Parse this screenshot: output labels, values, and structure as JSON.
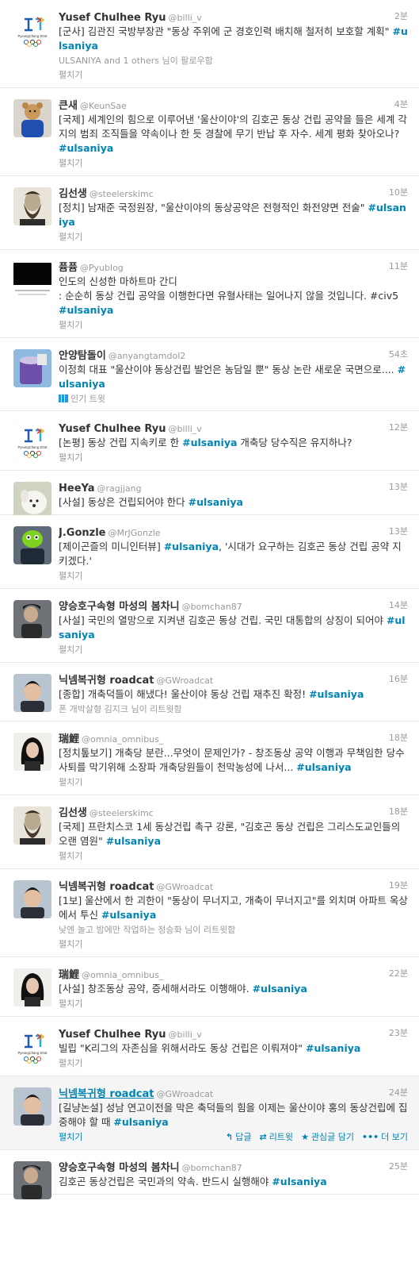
{
  "feed": {
    "tweets": [
      {
        "name": "Yusef Chulhee Ryu",
        "handle": "@billi_v",
        "time": "2분",
        "avatar": "pyeongchang-logo",
        "avatar_caption": "PyeongChang 2018",
        "text": "[군사] 김관진 국방부장관 \"동상 주위에 군 경호인력 배치해 철저히 보호할 계획\" ",
        "hashtag": "#ulsaniya",
        "context": "ULSANIYA and 1 others 님이 팔로우함",
        "expand": "펼치기"
      },
      {
        "name": "큰새",
        "handle": "@KeunSae",
        "time": "4분",
        "avatar": "blue-teddy-bear",
        "text": "[국제] 세계인의 힘으로 이루어낸 '울산이야'의 김호곤 동상 건립 공약을 들은 세계 각지의 범죄 조직들을 약속이나 한 듯 경찰에 무기 반납 후 자수. 세계 평화 찾아오나? ",
        "hashtag": "#ulsaniya",
        "expand": "펼치기"
      },
      {
        "name": "김선생",
        "handle": "@steelerskimc",
        "time": "10분",
        "avatar": "bearded-man-portrait",
        "text": "[정치] 남재준 국정원장, \"울산이야의 동상공약은 전형적인 화전양면 전술\" ",
        "hashtag": "#ulsaniya",
        "expand": "펼치기"
      },
      {
        "name": "퓸퓸",
        "handle": "@Pyublog",
        "time": "11분",
        "avatar": "black-banner",
        "text": "인도의 신성한 마하트마 간디\n: 순순히 동상 건립 공약을 이행한다면 유혈사태는 일어나지 않을 것입니다. #civ5 ",
        "hashtag": "#ulsaniya",
        "expand": "펼치기"
      },
      {
        "name": "안양탐돌이",
        "handle": "@anyangtamdol2",
        "time": "54초",
        "avatar": "purple-cup",
        "text": "이정희 대표 \"울산이야 동상건립 발언은 농담일 뿐\" 동상 논란 새로운 국면으로.... ",
        "hashtag": "#ulsaniya",
        "popular": "인기 트윗",
        "expand": ""
      },
      {
        "name": "Yusef Chulhee Ryu",
        "handle": "@billi_v",
        "time": "12분",
        "avatar": "pyeongchang-logo",
        "avatar_caption": "PyeongChang 2018",
        "text": "[논평] 동상 건립 지속키로 한 ",
        "hashtag": "#ulsaniya",
        "text_after": " 개축당 당수직은 유지하나?",
        "expand": "펼치기"
      },
      {
        "name": "HeeYa",
        "handle": "@ragjjang",
        "time": "13분",
        "avatar": "white-puppy",
        "text": "[사설] 동상은 건립되어야 한다 ",
        "hashtag": "#ulsaniya",
        "expand": ""
      },
      {
        "name": "J.Gonzle",
        "handle": "@MrJGonzle",
        "time": "13분",
        "avatar": "green-creature",
        "text": "[제이곤즐의 미니인터뷰] ",
        "hashtag": "#ulsaniya",
        "text_after": ", '시대가 요구하는 김호곤 동상 건립 공약 지키겠다.'",
        "expand": "펼치기"
      },
      {
        "name": "양승호구속형 마성의 봄차니",
        "handle": "@bomchan87",
        "time": "14분",
        "avatar": "dark-portrait",
        "text": "[사설] 국민의 열망으로 지켜낸 김호곤 동상 건립. 국민 대통합의 상징이 되어야 ",
        "hashtag": "#ulsaniya",
        "expand": "펼치기"
      },
      {
        "name": "닉넴복귀형 roadcat",
        "handle": "@GWroadcat",
        "time": "16분",
        "avatar": "boy-photo",
        "text": "[종합] 개축덕들이 해냈다! 울산이야 동상 건립 재추진 확정! ",
        "hashtag": "#ulsaniya",
        "context": "폰 개박살형 김지크 님이 리트윗함",
        "expand": ""
      },
      {
        "name": "瑞鯉",
        "handle": "@omnia_omnibus_",
        "time": "18분",
        "avatar": "girl-portrait",
        "text": "[정치톺보기] 개축당 분란...무엇이 문제인가? - 창조동상 공약 이행과 무책임한 당수 사퇴를 막기위해 소장파 개축당원들이 천막농성에 나서... ",
        "hashtag": "#ulsaniya",
        "expand": "펼치기"
      },
      {
        "name": "김선생",
        "handle": "@steelerskimc",
        "time": "18분",
        "avatar": "bearded-man-portrait",
        "text": "[국제] 프란치스코 1세 동상건립 촉구 강론, \"김호곤 동상 건립은 그리스도교인들의 오랜 염원\" ",
        "hashtag": "#ulsaniya",
        "expand": "펼치기"
      },
      {
        "name": "닉넴복귀형 roadcat",
        "handle": "@GWroadcat",
        "time": "19분",
        "avatar": "boy-photo",
        "text": "[1보] 울산에서 한 괴한이 \"동상이 무너지고, 개축이 무너지고\"를 외치며 아파트 옥상에서 투신 ",
        "hashtag": "#ulsaniya",
        "context": "낮엔 놀고 밤에만 작업하는 정승화 님이 리트윗함",
        "expand": "펼치기"
      },
      {
        "name": "瑞鯉",
        "handle": "@omnia_omnibus_",
        "time": "22분",
        "avatar": "girl-portrait",
        "text": "[사설] 창조동상 공약, 증세해서라도 이행해야. ",
        "hashtag": "#ulsaniya",
        "expand": "펼치기"
      },
      {
        "name": "Yusef Chulhee Ryu",
        "handle": "@billi_v",
        "time": "23분",
        "avatar": "pyeongchang-logo",
        "avatar_caption": "PyeongChang 2018",
        "text": "빌립 \"K리그의 자존심을 위해서라도 동상 건립은 이뤄져야\" ",
        "hashtag": "#ulsaniya",
        "expand": "펼치기"
      },
      {
        "name": "닉넴복귀형 roadcat",
        "handle": "@GWroadcat",
        "time": "24분",
        "avatar": "boy-photo",
        "text": "[길냥논설] 성남 연고이전을 막은 축덕들의 힘을 이제는 울산이야 홍의 동상건립에 집중해야 할 때 ",
        "hashtag": "#ulsaniya",
        "expand": "펼치기",
        "hover": true,
        "actions": {
          "reply": "답글",
          "retweet": "리트윗",
          "favorite": "관심글 담기",
          "more": "더 보기"
        }
      },
      {
        "name": "양승호구속형 마성의 봄차니",
        "handle": "@bomchan87",
        "time": "25분",
        "avatar": "dark-portrait",
        "text": "김호곤 동상건립은 국민과의 약속. 반드시 실행해야 ",
        "hashtag": "#ulsaniya",
        "expand": ""
      }
    ]
  },
  "colors": {
    "link": "#0084b4",
    "meta": "#999999",
    "text": "#333333",
    "border": "#e8e8e8",
    "hover_bg": "#f5f5f5"
  }
}
